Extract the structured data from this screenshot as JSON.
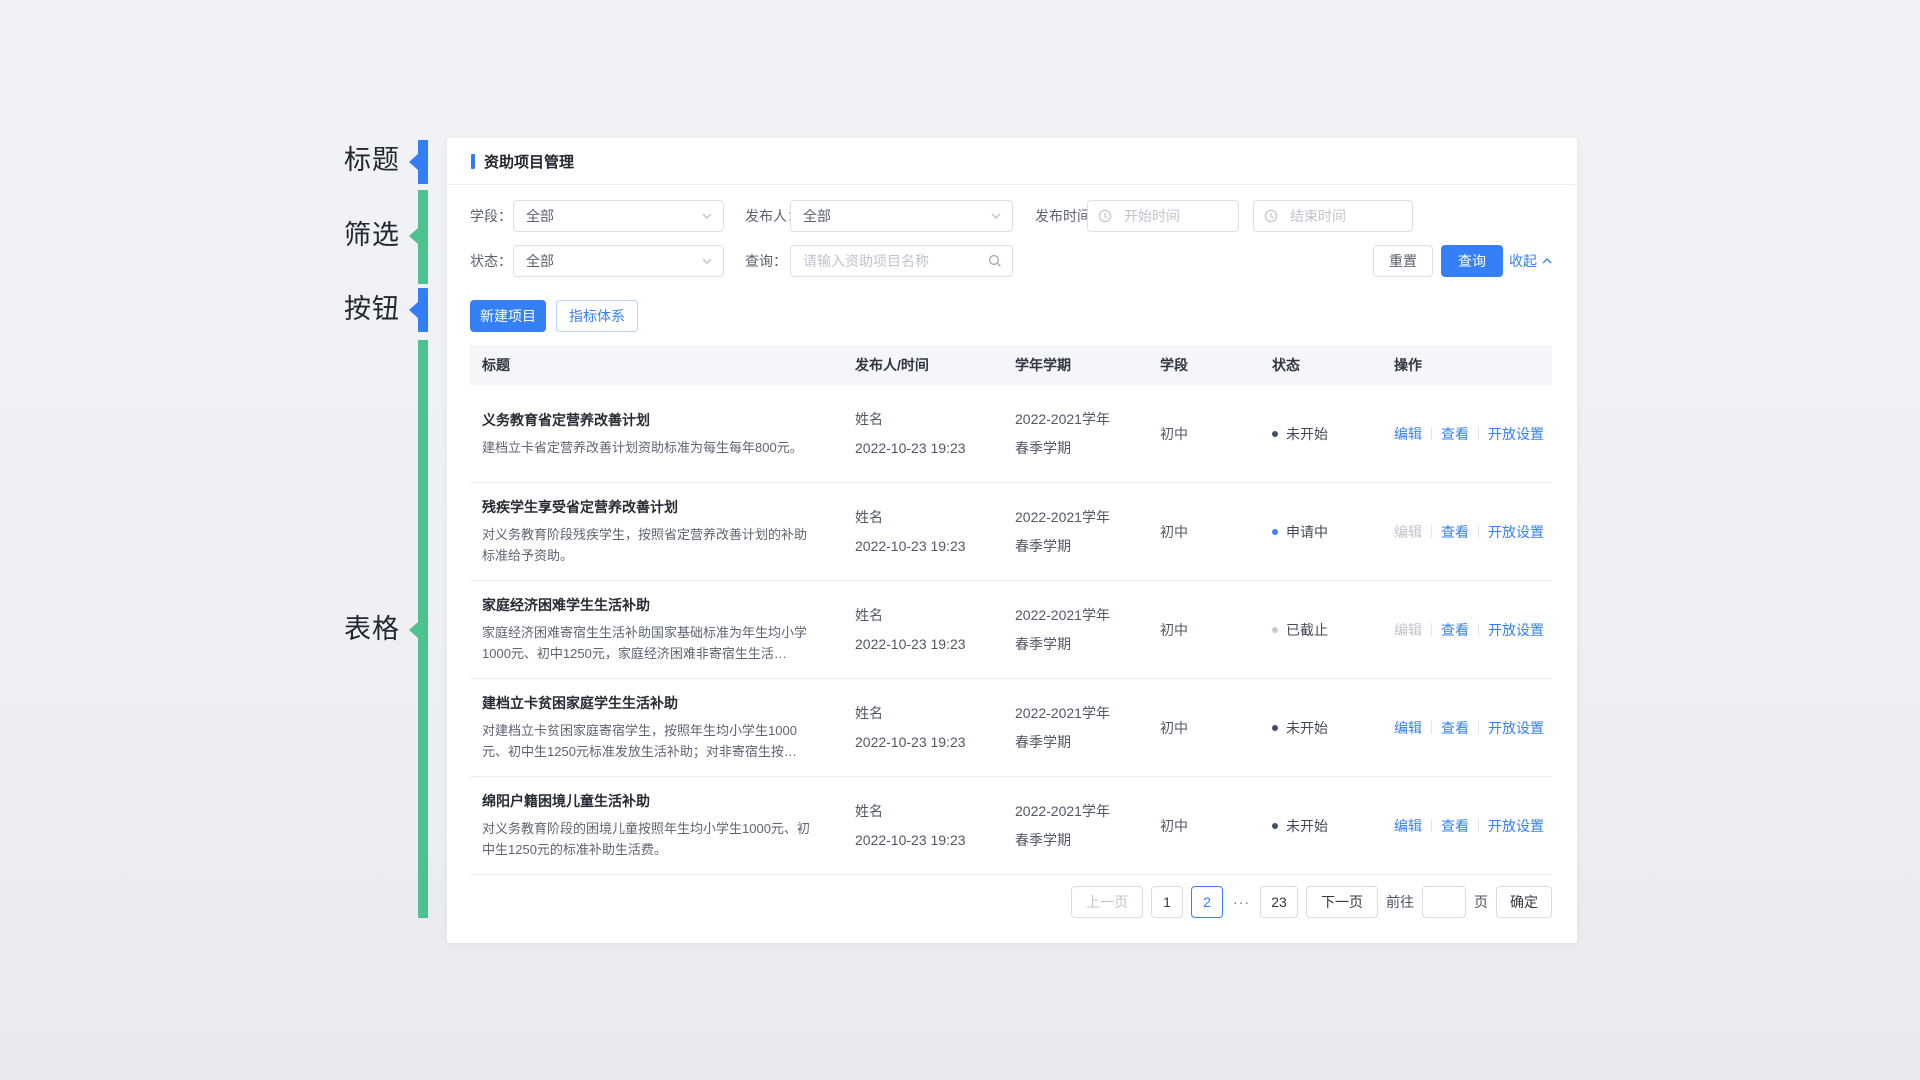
{
  "annotations": {
    "title_label": "标题",
    "filter_label": "筛选",
    "button_label": "按钮",
    "table_label": "表格"
  },
  "header": {
    "title": "资助项目管理"
  },
  "filters": {
    "stage_label": "学段：",
    "stage_value": "全部",
    "publisher_label": "发布人：",
    "publisher_value": "全部",
    "publish_time_label": "发布时间:",
    "start_placeholder": "开始时间",
    "end_placeholder": "结束时间",
    "status_label": "状态：",
    "status_value": "全部",
    "search_label": "查询：",
    "search_placeholder": "请输入资助项目名称",
    "reset_label": "重置",
    "query_label": "查询",
    "collapse_label": "收起"
  },
  "toolbar": {
    "new_project_label": "新建项目",
    "indicator_system_label": "指标体系"
  },
  "table": {
    "headers": [
      "标题",
      "发布人/时间",
      "学年学期",
      "学段",
      "状态",
      "操作"
    ],
    "action_labels": [
      "编辑",
      "查看",
      "开放设置"
    ],
    "rows": [
      {
        "title": "义务教育省定营养改善计划",
        "desc": "建档立卡省定营养改善计划资助标准为每生每年800元。",
        "publisher": "姓名",
        "time": "2022-10-23 19:23",
        "year": "2022-2021学年",
        "semester": "春季学期",
        "stage": "初中",
        "status": "未开始",
        "status_type": "not_started",
        "edit_enabled": true
      },
      {
        "title": "残疾学生享受省定营养改善计划",
        "desc": "对义务教育阶段残疾学生，按照省定营养改善计划的补助标准给予资助。",
        "publisher": "姓名",
        "time": "2022-10-23 19:23",
        "year": "2022-2021学年",
        "semester": "春季学期",
        "stage": "初中",
        "status": "申请中",
        "status_type": "applying",
        "edit_enabled": false
      },
      {
        "title": "家庭经济困难学生生活补助",
        "desc": "家庭经济困难寄宿生生活补助国家基础标准为年生均小学1000元、初中1250元，家庭经济困难非寄宿生生活…",
        "publisher": "姓名",
        "time": "2022-10-23 19:23",
        "year": "2022-2021学年",
        "semester": "春季学期",
        "stage": "初中",
        "status": "已截止",
        "status_type": "closed",
        "edit_enabled": false
      },
      {
        "title": "建档立卡贫困家庭学生生活补助",
        "desc": "对建档立卡贫困家庭寄宿学生，按照年生均小学生1000元、初中生1250元标准发放生活补助；对非寄宿生按…",
        "publisher": "姓名",
        "time": "2022-10-23 19:23",
        "year": "2022-2021学年",
        "semester": "春季学期",
        "stage": "初中",
        "status": "未开始",
        "status_type": "not_started",
        "edit_enabled": true
      },
      {
        "title": "绵阳户籍困境儿童生活补助",
        "desc": "对义务教育阶段的困境儿童按照年生均小学生1000元、初中生1250元的标准补助生活费。",
        "publisher": "姓名",
        "time": "2022-10-23 19:23",
        "year": "2022-2021学年",
        "semester": "春季学期",
        "stage": "初中",
        "status": "未开始",
        "status_type": "not_started",
        "edit_enabled": true
      }
    ]
  },
  "pagination": {
    "prev_label": "上一页",
    "page_1": "1",
    "page_2": "2",
    "ellipsis": "···",
    "page_last": "23",
    "next_label": "下一页",
    "goto_label": "前往",
    "unit_label": "页",
    "confirm_label": "确定",
    "current_page": "2"
  },
  "colors": {
    "accent_blue": "#3580f7",
    "annotation_green": "#4dc28e",
    "status_not_started": "#3f4e6e",
    "status_applying": "#3b82f6",
    "status_closed": "#c6cad2"
  }
}
